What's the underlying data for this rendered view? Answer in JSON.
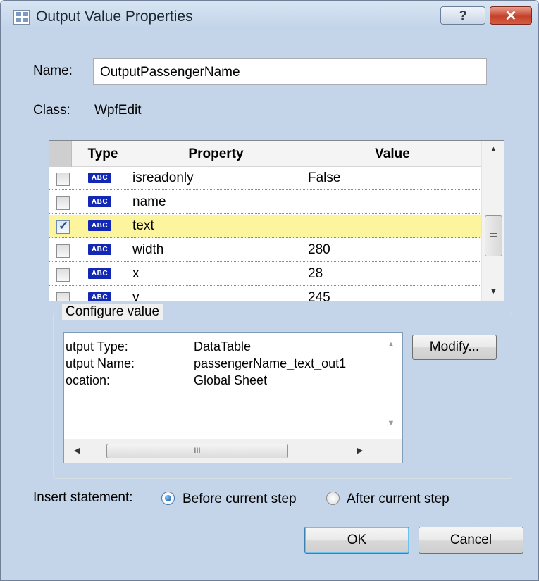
{
  "window": {
    "title": "Output Value Properties",
    "help_label": "?",
    "close_label": "✕"
  },
  "fields": {
    "name_label": "Name:",
    "name_value": "OutputPassengerName",
    "class_label": "Class:",
    "class_value": "WpfEdit"
  },
  "properties_table": {
    "headers": {
      "type": "Type",
      "property": "Property",
      "value": "Value"
    },
    "rows": [
      {
        "checked": false,
        "type_icon": "ABC",
        "property": "isreadonly",
        "value": "False"
      },
      {
        "checked": false,
        "type_icon": "ABC",
        "property": "name",
        "value": ""
      },
      {
        "checked": true,
        "type_icon": "ABC",
        "property": "text",
        "value": ""
      },
      {
        "checked": false,
        "type_icon": "ABC",
        "property": "width",
        "value": "280"
      },
      {
        "checked": false,
        "type_icon": "ABC",
        "property": "x",
        "value": "28"
      },
      {
        "checked": false,
        "type_icon": "ABC",
        "property": "y",
        "value": "245"
      }
    ],
    "selected_row_color": "#fcf59d"
  },
  "configure": {
    "title": "Configure value",
    "lines": [
      {
        "label": "utput Type:",
        "value": "DataTable"
      },
      {
        "label": "utput Name:",
        "value": "passengerName_text_out1"
      },
      {
        "label": "ocation:",
        "value": "Global Sheet"
      }
    ],
    "modify_label": "Modify...",
    "hscroll_grip": "III"
  },
  "insert": {
    "label": "Insert statement:",
    "before_label": "Before current step",
    "after_label": "After current step",
    "selected": "before"
  },
  "buttons": {
    "ok": "OK",
    "cancel": "Cancel"
  }
}
